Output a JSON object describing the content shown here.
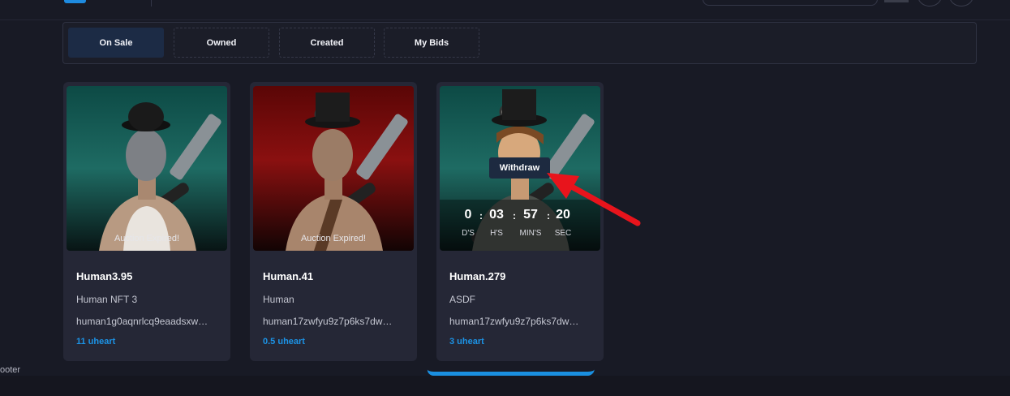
{
  "tabs": [
    {
      "label": "On Sale"
    },
    {
      "label": "Owned"
    },
    {
      "label": "Created"
    },
    {
      "label": "My Bids"
    }
  ],
  "cards": [
    {
      "title": "Human3.95",
      "description": "Human NFT 3",
      "owner": "human1g0aqnrlcq9eaadsxw…",
      "price": "11 uheart",
      "status": "Auction Expired!",
      "background": "teal"
    },
    {
      "title": "Human.41",
      "description": "Human",
      "owner": "human17zwfyu9z7p6ks7dw…",
      "price": "0.5 uheart",
      "status": "Auction Expired!",
      "background": "red"
    },
    {
      "title": "Human.279",
      "description": "ASDF",
      "owner": "human17zwfyu9z7p6ks7dw…",
      "price": "3 uheart",
      "background": "teal",
      "countdown": {
        "days": "0",
        "hours": "03",
        "minutes": "57",
        "seconds": "20",
        "days_label": "D'S",
        "hours_label": "H'S",
        "minutes_label": "MIN'S",
        "seconds_label": "SEC"
      },
      "action": "Withdraw"
    }
  ],
  "footer": {
    "label": "ooter"
  },
  "colors": {
    "accent": "#1c93e6",
    "annotation_arrow": "#e8141c",
    "page_bg": "#181a25",
    "card_bg": "#252736"
  }
}
